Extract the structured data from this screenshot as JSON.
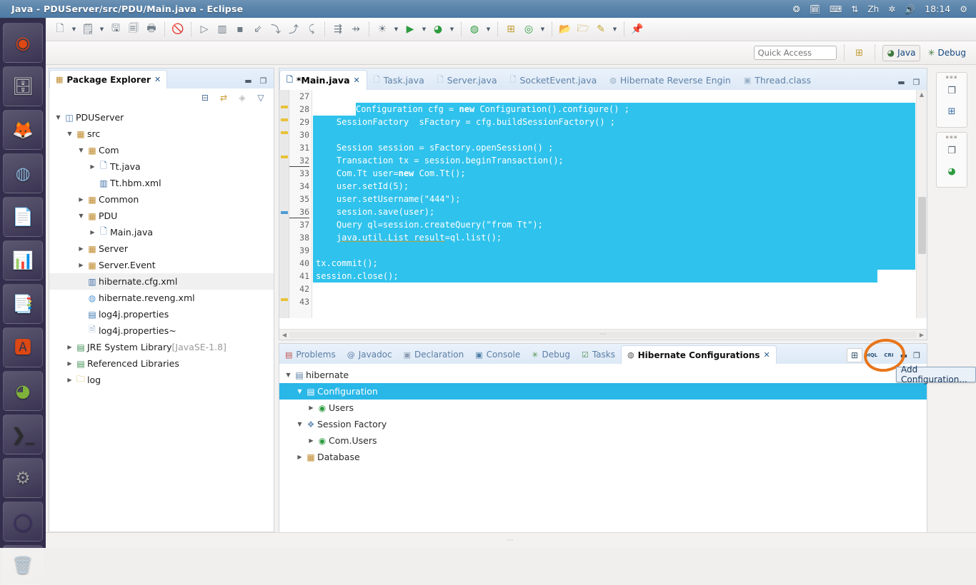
{
  "os": {
    "window_title": "Java - PDUServer/src/PDU/Main.java - Eclipse",
    "clock": "18:14",
    "tray_icons": [
      "dropbox-icon",
      "calendar-icon",
      "keyboard-layout-icon",
      "network-updown-icon",
      "input-method-zh-icon",
      "bluetooth-icon",
      "volume-icon",
      "system-settings-icon"
    ],
    "tray_input_method": "Zh",
    "launcher_items": [
      {
        "name": "ubuntu-dash-icon",
        "glyph": "◉",
        "color": "#dd4814"
      },
      {
        "name": "files-icon",
        "glyph": "🗄",
        "color": "#c9c9c9"
      },
      {
        "name": "firefox-icon",
        "glyph": "🦊",
        "color": "#e66000"
      },
      {
        "name": "chromium-icon",
        "glyph": "◍",
        "color": "#8ab4d8"
      },
      {
        "name": "libreoffice-writer-icon",
        "glyph": "📄",
        "color": "#2a6099"
      },
      {
        "name": "libreoffice-calc-icon",
        "glyph": "📊",
        "color": "#37a72c"
      },
      {
        "name": "libreoffice-impress-icon",
        "glyph": "📑",
        "color": "#d18b18"
      },
      {
        "name": "ubuntu-software-center-icon",
        "glyph": "🅰",
        "color": "#dd4814"
      },
      {
        "name": "help-icon",
        "glyph": "◕",
        "color": "#7fb23a"
      },
      {
        "name": "terminal-icon",
        "glyph": "❯_",
        "color": "#2c2c2c"
      },
      {
        "name": "system-tools-icon",
        "glyph": "⚙",
        "color": "#9b9b9b"
      },
      {
        "name": "eclipse-icon",
        "glyph": "◯",
        "color": "#3b2d63"
      },
      {
        "name": "trash-icon",
        "glyph": "🗑",
        "color": "#c0d3e3"
      }
    ]
  },
  "toolbar": {
    "groups": [
      {
        "buttons": [
          {
            "name": "new-wizard-button",
            "glyph": "🗋",
            "dropdown": true
          },
          {
            "name": "new-java-project-button",
            "glyph": "🗒",
            "dropdown": true
          },
          {
            "name": "save-button",
            "glyph": "🖫",
            "dropdown": false
          },
          {
            "name": "save-all-button",
            "glyph": "🗐",
            "dropdown": false
          },
          {
            "name": "print-button",
            "glyph": "🖶",
            "dropdown": false
          }
        ]
      },
      {
        "buttons": [
          {
            "name": "toggle-breakpoint-button",
            "glyph": "🚫",
            "dropdown": false
          }
        ]
      },
      {
        "buttons": [
          {
            "name": "resume-button",
            "glyph": "▷",
            "dropdown": false
          },
          {
            "name": "suspend-button",
            "glyph": "▥",
            "dropdown": false
          },
          {
            "name": "terminate-button",
            "glyph": "▪",
            "dropdown": false
          },
          {
            "name": "step-into-button",
            "glyph": "⇙",
            "dropdown": false
          },
          {
            "name": "step-over-button",
            "glyph": "⤵",
            "dropdown": false
          },
          {
            "name": "step-return-button",
            "glyph": "⤴",
            "dropdown": false
          },
          {
            "name": "drop-to-frame-button",
            "glyph": "⤹",
            "dropdown": false
          }
        ]
      },
      {
        "buttons": [
          {
            "name": "use-step-filters-button",
            "glyph": "⇶",
            "dropdown": false
          },
          {
            "name": "disconnect-button",
            "glyph": "⇸",
            "dropdown": false
          }
        ]
      },
      {
        "buttons": [
          {
            "name": "external-tools-button",
            "glyph": "☀",
            "dropdown": true
          },
          {
            "name": "run-button",
            "glyph": "▶",
            "dropdown": true,
            "color": "#2c9b3f"
          },
          {
            "name": "debug-button",
            "glyph": "◕",
            "dropdown": true,
            "color": "#2c9b3f"
          }
        ]
      },
      {
        "buttons": [
          {
            "name": "coverage-button",
            "glyph": "◍",
            "dropdown": true,
            "color": "#2c9b3f"
          }
        ]
      },
      {
        "buttons": [
          {
            "name": "new-package-button",
            "glyph": "⊞",
            "dropdown": false,
            "color": "#c29b33"
          },
          {
            "name": "open-type-button",
            "glyph": "◎",
            "dropdown": true,
            "color": "#2c9b3f"
          }
        ]
      },
      {
        "buttons": [
          {
            "name": "open-resource-button",
            "glyph": "📂",
            "dropdown": false,
            "color": "#c29b33"
          },
          {
            "name": "previous-annotation-button",
            "glyph": "🗁",
            "dropdown": false,
            "color": "#c29b33"
          },
          {
            "name": "next-annotation-button",
            "glyph": "✎",
            "dropdown": true,
            "color": "#c2a62e"
          }
        ]
      },
      {
        "buttons": [
          {
            "name": "pin-editor-button",
            "glyph": "📌",
            "dropdown": false
          }
        ]
      }
    ]
  },
  "quick_access": {
    "placeholder": "Quick Access",
    "value": "",
    "new-perspective-icon": "⊞",
    "perspectives": [
      {
        "name": "perspective-java",
        "label": "Java",
        "active": true,
        "icon": "java-perspective-icon"
      },
      {
        "name": "perspective-debug",
        "label": "Debug",
        "active": false,
        "icon": "debug-perspective-icon"
      }
    ]
  },
  "package_explorer": {
    "tab_label": "Package Explorer",
    "tab_icon": "package-explorer-icon",
    "close_glyph": "✕",
    "minimize_glyph": "▬",
    "maximize_glyph": "❐",
    "toolbar_icons": [
      "collapse-all-icon",
      "link-with-editor-icon",
      "focus-on-active-task-icon",
      "view-menu-icon"
    ],
    "tree": [
      {
        "indent": 0,
        "twisty": "▼",
        "icon": "java-project-icon",
        "label": "PDUServer",
        "selected": false
      },
      {
        "indent": 1,
        "twisty": "▼",
        "icon": "source-folder-icon",
        "label": "src",
        "selected": false
      },
      {
        "indent": 2,
        "twisty": "▼",
        "icon": "package-icon",
        "label": "Com",
        "selected": false
      },
      {
        "indent": 3,
        "twisty": "▶",
        "icon": "java-file-icon",
        "label": "Tt.java",
        "selected": false
      },
      {
        "indent": 3,
        "twisty": "",
        "icon": "xml-mapping-icon",
        "label": "Tt.hbm.xml",
        "selected": false
      },
      {
        "indent": 2,
        "twisty": "▶",
        "icon": "package-icon",
        "label": "Common",
        "selected": false
      },
      {
        "indent": 2,
        "twisty": "▼",
        "icon": "package-icon",
        "label": "PDU",
        "selected": false
      },
      {
        "indent": 3,
        "twisty": "▶",
        "icon": "java-file-icon",
        "label": "Main.java",
        "selected": false
      },
      {
        "indent": 2,
        "twisty": "▶",
        "icon": "package-icon",
        "label": "Server",
        "selected": false
      },
      {
        "indent": 2,
        "twisty": "▶",
        "icon": "package-icon",
        "label": "Server.Event",
        "selected": false
      },
      {
        "indent": 2,
        "twisty": "",
        "icon": "xml-config-icon",
        "label": "hibernate.cfg.xml",
        "selected": true
      },
      {
        "indent": 2,
        "twisty": "",
        "icon": "hibernate-icon",
        "label": "hibernate.reveng.xml",
        "selected": false
      },
      {
        "indent": 2,
        "twisty": "",
        "icon": "properties-icon",
        "label": "log4j.properties",
        "selected": false
      },
      {
        "indent": 2,
        "twisty": "",
        "icon": "file-icon",
        "label": "log4j.properties~",
        "selected": false
      },
      {
        "indent": 1,
        "twisty": "▶",
        "icon": "library-icon",
        "label": "JRE System Library",
        "suffix": "[JavaSE-1.8]",
        "selected": false
      },
      {
        "indent": 1,
        "twisty": "▶",
        "icon": "library-icon",
        "label": "Referenced Libraries",
        "selected": false
      },
      {
        "indent": 1,
        "twisty": "▶",
        "icon": "folder-icon",
        "label": "log",
        "selected": false
      }
    ]
  },
  "editor": {
    "tabs": [
      {
        "label": "*Main.java",
        "icon": "java-file-icon",
        "active": true,
        "closable": true
      },
      {
        "label": "Task.java",
        "icon": "java-file-icon",
        "active": false,
        "closable": false
      },
      {
        "label": "Server.java",
        "icon": "java-file-icon",
        "active": false,
        "closable": false
      },
      {
        "label": "SocketEvent.java",
        "icon": "java-file-icon",
        "active": false,
        "closable": false
      },
      {
        "label": "Hibernate Reverse Engin",
        "icon": "hibernate-icon",
        "active": false,
        "closable": false
      },
      {
        "label": "Thread.class",
        "icon": "class-file-icon",
        "active": false,
        "closable": false
      }
    ],
    "minimize_glyph": "▬",
    "maximize_glyph": "❐",
    "first_line_number": 27,
    "lines": [
      {
        "n": 27,
        "text": "",
        "hl": false,
        "marker": ""
      },
      {
        "n": 28,
        "text": "Configuration cfg = new Configuration().configure() ;",
        "hl": true,
        "marker": "",
        "indent": 0
      },
      {
        "n": 29,
        "text": "SessionFactory  sFactory = cfg.buildSessionFactory() ;",
        "hl": true,
        "marker": "",
        "indent": 1
      },
      {
        "n": 30,
        "text": "",
        "hl": true,
        "marker": ""
      },
      {
        "n": 31,
        "text": "Session session = sFactory.openSession() ;",
        "hl": true,
        "marker": "",
        "indent": 1
      },
      {
        "n": 32,
        "text": "Transaction tx = session.beginTransaction();",
        "hl": true,
        "marker": "",
        "indent": 1,
        "current": true
      },
      {
        "n": 33,
        "text": "Com.Tt user=new Com.Tt();",
        "hl": true,
        "marker": "",
        "indent": 1
      },
      {
        "n": 34,
        "text": "user.setId(5);",
        "hl": true,
        "marker": "",
        "indent": 1
      },
      {
        "n": 35,
        "text": "user.setUsername(\"444\");",
        "hl": true,
        "marker": "",
        "indent": 1
      },
      {
        "n": 36,
        "text": "session.save(user);",
        "hl": true,
        "marker": "",
        "indent": 1,
        "current": true
      },
      {
        "n": 37,
        "text": "Query ql=session.createQuery(\"from Tt\");",
        "hl": true,
        "marker": "breakpoint",
        "indent": 1
      },
      {
        "n": 38,
        "text": "java.util.List result=ql.list();",
        "hl": true,
        "marker": "warning",
        "indent": 1,
        "warn": true
      },
      {
        "n": 39,
        "text": "",
        "hl": true,
        "marker": ""
      },
      {
        "n": 40,
        "text": "tx.commit();",
        "hl": true,
        "marker": "",
        "indent": 0
      },
      {
        "n": 41,
        "text": "session.close();",
        "hl": true,
        "marker": "breakpoint",
        "indent": 0
      },
      {
        "n": 42,
        "text": "",
        "hl": false,
        "marker": ""
      },
      {
        "n": 43,
        "text": "",
        "hl": false,
        "marker": ""
      }
    ],
    "selection_color": "#2fc2ec"
  },
  "bottom_view": {
    "tabs": [
      {
        "label": "Problems",
        "icon": "problems-icon",
        "active": false
      },
      {
        "label": "Javadoc",
        "icon": "javadoc-icon",
        "active": false
      },
      {
        "label": "Declaration",
        "icon": "declaration-icon",
        "active": false
      },
      {
        "label": "Console",
        "icon": "console-icon",
        "active": false
      },
      {
        "label": "Debug",
        "icon": "debug-icon",
        "active": false
      },
      {
        "label": "Tasks",
        "icon": "tasks-icon",
        "active": false
      },
      {
        "label": "Hibernate Configurations",
        "icon": "hibernate-icon",
        "active": true,
        "closable": true
      }
    ],
    "close_glyph": "✕",
    "minimize_glyph": "▬",
    "maximize_glyph": "❐",
    "actions": [
      {
        "name": "add-configuration-button",
        "glyph": "⊞",
        "highlighted": true
      },
      {
        "name": "hql-editor-button",
        "glyph": "HQL"
      },
      {
        "name": "criteria-editor-button",
        "glyph": "CRI"
      }
    ],
    "tooltip": "Add Configuration...",
    "annotation": {
      "shape": "hand-drawn-circle",
      "color": "#e8761b"
    },
    "tree": [
      {
        "indent": 0,
        "twisty": "▼",
        "icon": "hibernate-console-icon",
        "label": "hibernate",
        "selected": false
      },
      {
        "indent": 1,
        "twisty": "▼",
        "icon": "configuration-icon",
        "label": "Configuration",
        "selected": true
      },
      {
        "indent": 2,
        "twisty": "▶",
        "icon": "class-icon",
        "label": "Users",
        "selected": false
      },
      {
        "indent": 1,
        "twisty": "▼",
        "icon": "session-factory-icon",
        "label": "Session Factory",
        "selected": false
      },
      {
        "indent": 2,
        "twisty": "▶",
        "icon": "class-icon",
        "label": "Com.Users",
        "selected": false
      },
      {
        "indent": 1,
        "twisty": "▶",
        "icon": "database-icon",
        "label": "Database",
        "selected": false
      }
    ]
  },
  "right_bar": {
    "groups": [
      {
        "icons": [
          "restore-icon",
          "outline-icon"
        ]
      },
      {
        "icons": [
          "restore-icon",
          "hibernate-configurations-icon"
        ]
      }
    ]
  },
  "colors": {
    "selection": "#2fc2ec",
    "tree_selection": "#29b7e8",
    "annotation": "#e8761b",
    "tab_active_bg": "#ffffff",
    "panel_bg": "#f3f2f1",
    "titlebar": "#5d86ac"
  }
}
